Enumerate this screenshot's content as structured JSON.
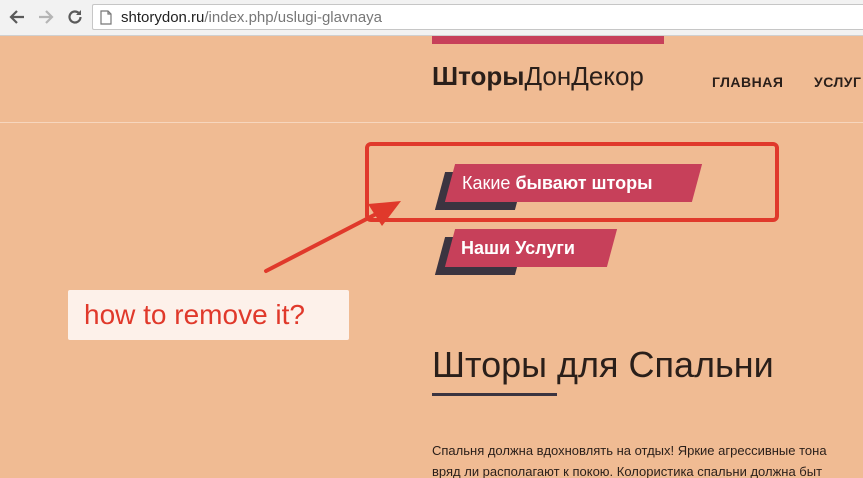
{
  "browser": {
    "url_host": "shtorydon.ru",
    "url_path": "/index.php/uslugi-glavnaya"
  },
  "site": {
    "logo_bold": "Шторы",
    "logo_regular": "ДонДекор",
    "nav": [
      "ГЛАВНАЯ",
      "УСЛУГ"
    ]
  },
  "tags": [
    {
      "regular": "Какие ",
      "bold": "бывают шторы"
    },
    {
      "regular": "",
      "bold": "Наши Услуги"
    }
  ],
  "annotation": {
    "callout_text": "how to remove it?"
  },
  "content": {
    "title": "Шторы для Спальни",
    "paragraph_lines": [
      "Спальня должна вдохновлять на отдых! Яркие агрессивные тона",
      "вряд ли располагают к покою. Колористика спальни должна быт"
    ]
  },
  "colors": {
    "page_bg": "#f0bb93",
    "accent": "#c7405a",
    "annotation_red": "#e0392b",
    "dark": "#3b3440"
  },
  "icons": [
    "back-arrow-icon",
    "forward-arrow-icon",
    "reload-icon",
    "page-icon"
  ]
}
